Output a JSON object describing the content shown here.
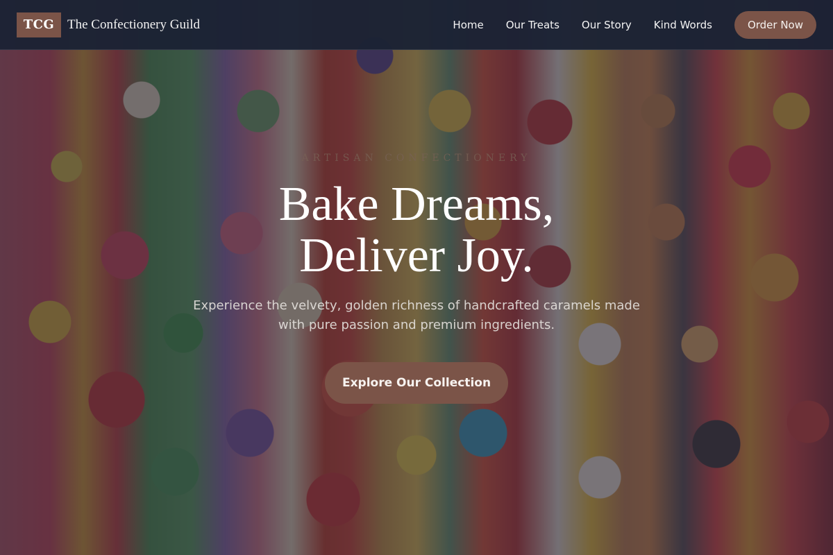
{
  "site": {
    "logo_text": "TCG",
    "name": "The Confectionery Guild"
  },
  "nav": {
    "links": [
      {
        "label": "Home"
      },
      {
        "label": "Our Treats"
      },
      {
        "label": "Our Story"
      },
      {
        "label": "Kind Words"
      }
    ],
    "cta_label": "Order Now"
  },
  "hero": {
    "eyebrow": "ARTISAN CONFECTIONERY",
    "headline_line1": "Bake Dreams,",
    "headline_line2": "Deliver Joy.",
    "subtext": "Experience the velvety, golden richness of handcrafted caramels made with pure passion and premium ingredients.",
    "cta_label": "Explore Our Collection"
  },
  "colors": {
    "accent": "#7b5448",
    "navbar_bg": "#1b2234",
    "overlay": "#262130"
  }
}
